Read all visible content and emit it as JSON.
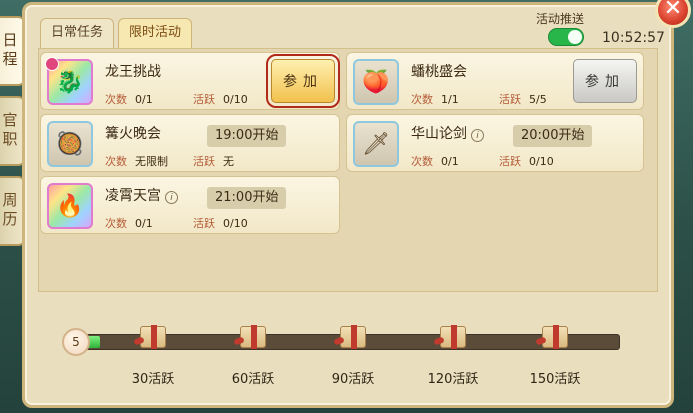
{
  "side_tabs": [
    {
      "label": "日程"
    },
    {
      "label": "官职"
    },
    {
      "label": "周历"
    }
  ],
  "tabs": [
    {
      "label": "日常任务"
    },
    {
      "label": "限时活动"
    }
  ],
  "push": {
    "label": "活动推送",
    "enabled": true
  },
  "clock": "10:52:57",
  "activities": [
    {
      "name": "龙王挑战",
      "count_label": "次数",
      "count": "0/1",
      "active_label": "活跃",
      "active": "0/10",
      "button": "参加",
      "button_style": "gold",
      "icon": "dragon-emblem-icon"
    },
    {
      "name": "蟠桃盛会",
      "count_label": "次数",
      "count": "1/1",
      "active_label": "活跃",
      "active": "5/5",
      "button": "参加",
      "button_style": "grey",
      "icon": "peach-icon"
    },
    {
      "name": "篝火晚会",
      "count_label": "次数",
      "count": "无限制",
      "active_label": "活跃",
      "active": "无",
      "time": "19:00开始",
      "icon": "feast-plate-icon"
    },
    {
      "name": "华山论剑",
      "count_label": "次数",
      "count": "0/1",
      "active_label": "活跃",
      "active": "0/10",
      "time": "20:00开始",
      "icon": "sword-icon"
    },
    {
      "name": "凌霄天宫",
      "count_label": "次数",
      "count": "0/1",
      "active_label": "活跃",
      "active": "0/10",
      "time": "21:00开始",
      "icon": "fire-blade-icon"
    }
  ],
  "progress": {
    "current": 5,
    "max": 150,
    "fraction": 0.033
  },
  "rewards": [
    {
      "label": "30活跃"
    },
    {
      "label": "60活跃"
    },
    {
      "label": "90活跃"
    },
    {
      "label": "120活跃"
    },
    {
      "label": "150活跃"
    }
  ],
  "close_label": "✕"
}
